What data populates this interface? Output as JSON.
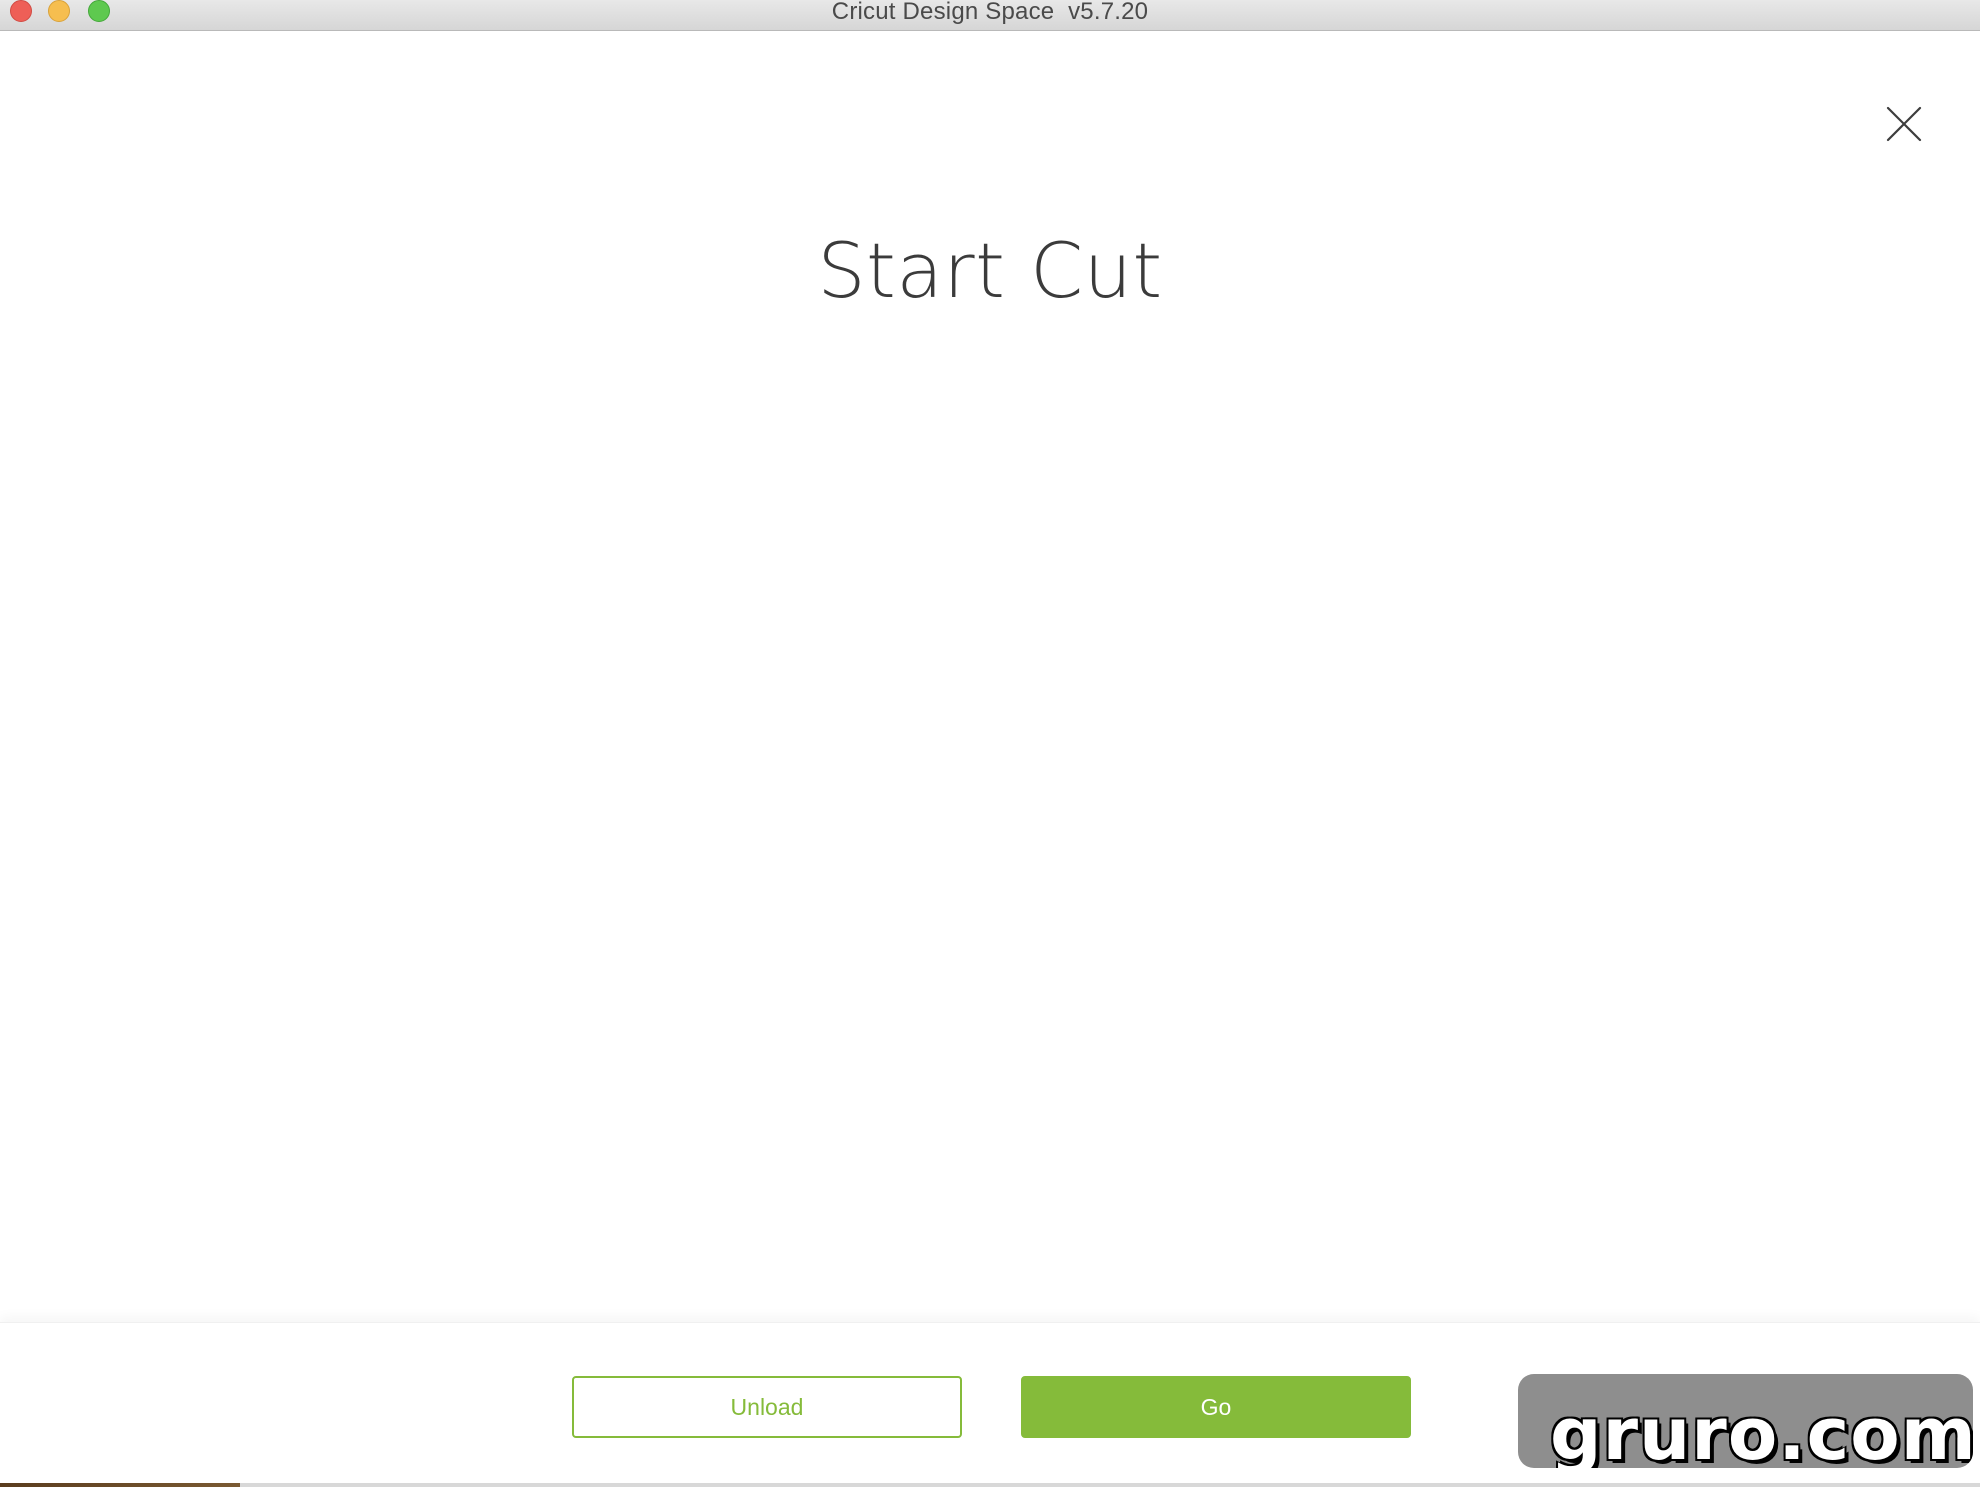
{
  "window": {
    "title": "Cricut Design Space  v5.7.20"
  },
  "dialog": {
    "close_icon": "close-icon",
    "title": "Start Cut"
  },
  "footer": {
    "unload_label": "Unload",
    "go_label": "Go"
  },
  "watermark": {
    "text": "gruro.com"
  },
  "colors": {
    "accent_green": "#85bb3a",
    "title_text": "#3b3b3b",
    "titlebar": "#dcdcdc"
  }
}
